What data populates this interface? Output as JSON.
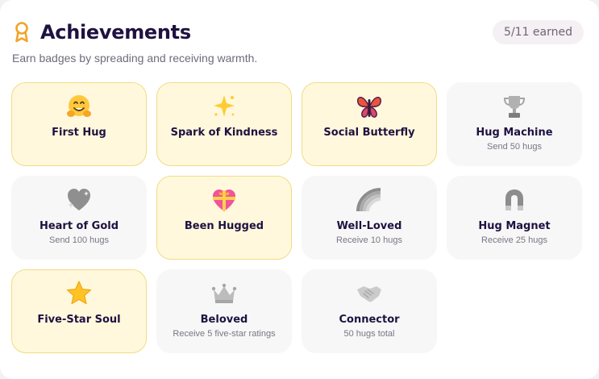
{
  "header": {
    "title": "Achievements",
    "earned_count": "5/11 earned",
    "subtitle": "Earn badges by spreading and receiving warmth."
  },
  "colors": {
    "earned_bg": "#fff8dd",
    "earned_border": "#f2dc80",
    "locked_bg": "#f7f7f8",
    "title": "#1e1240",
    "award_icon": "#f0a52a"
  },
  "badges": [
    {
      "name": "First Hug",
      "requirement": "",
      "earned": true,
      "icon": "hugging-face-icon"
    },
    {
      "name": "Spark of Kindness",
      "requirement": "",
      "earned": true,
      "icon": "sparkle-star-icon"
    },
    {
      "name": "Social Butterfly",
      "requirement": "",
      "earned": true,
      "icon": "butterfly-icon"
    },
    {
      "name": "Hug Machine",
      "requirement": "Send 50 hugs",
      "earned": false,
      "icon": "trophy-icon"
    },
    {
      "name": "Heart of Gold",
      "requirement": "Send 100 hugs",
      "earned": false,
      "icon": "sparkling-heart-icon"
    },
    {
      "name": "Been Hugged",
      "requirement": "",
      "earned": true,
      "icon": "gift-heart-icon"
    },
    {
      "name": "Well-Loved",
      "requirement": "Receive 10 hugs",
      "earned": false,
      "icon": "rainbow-icon"
    },
    {
      "name": "Hug Magnet",
      "requirement": "Receive 25 hugs",
      "earned": false,
      "icon": "magnet-icon"
    },
    {
      "name": "Five-Star Soul",
      "requirement": "",
      "earned": true,
      "icon": "star-icon"
    },
    {
      "name": "Beloved",
      "requirement": "Receive 5 five-star ratings",
      "earned": false,
      "icon": "crown-icon"
    },
    {
      "name": "Connector",
      "requirement": "50 hugs total",
      "earned": false,
      "icon": "handshake-icon"
    }
  ]
}
